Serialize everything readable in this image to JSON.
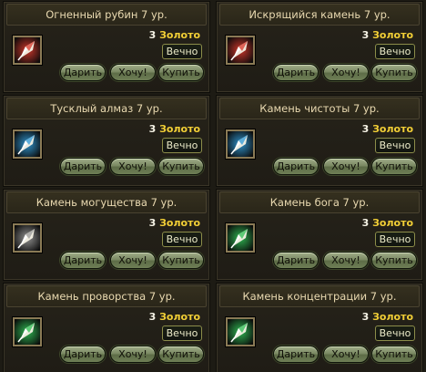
{
  "buttons": {
    "gift": "Дарить",
    "want": "Хочу!",
    "buy": "Купить"
  },
  "items": [
    {
      "title": "Огненный рубин 7 ур.",
      "price": "3",
      "currency": "Золото",
      "duration": "Вечно",
      "icon": "fire-ruby-icon",
      "color": "#d8382c"
    },
    {
      "title": "Искрящийся камень 7 ур.",
      "price": "3",
      "currency": "Золото",
      "duration": "Вечно",
      "icon": "sparkling-stone-icon",
      "color": "#d8382c"
    },
    {
      "title": "Тусклый алмаз 7 ур.",
      "price": "3",
      "currency": "Золото",
      "duration": "Вечно",
      "icon": "dull-diamond-icon",
      "color": "#2f9ad8"
    },
    {
      "title": "Камень чистоты 7 ур.",
      "price": "3",
      "currency": "Золото",
      "duration": "Вечно",
      "icon": "purity-stone-icon",
      "color": "#2f9ad8"
    },
    {
      "title": "Камень могущества 7 ур.",
      "price": "3",
      "currency": "Золото",
      "duration": "Вечно",
      "icon": "power-stone-icon",
      "color": "#9a9a9a"
    },
    {
      "title": "Камень бога 7 ур.",
      "price": "3",
      "currency": "Золото",
      "duration": "Вечно",
      "icon": "god-stone-icon",
      "color": "#2fbf55"
    },
    {
      "title": "Камень проворства 7 ур.",
      "price": "3",
      "currency": "Золото",
      "duration": "Вечно",
      "icon": "agility-stone-icon",
      "color": "#2fbf55"
    },
    {
      "title": "Камень концентрации 7 ур.",
      "price": "3",
      "currency": "Золото",
      "duration": "Вечно",
      "icon": "concentration-stone-icon",
      "color": "#2fbf55"
    }
  ]
}
